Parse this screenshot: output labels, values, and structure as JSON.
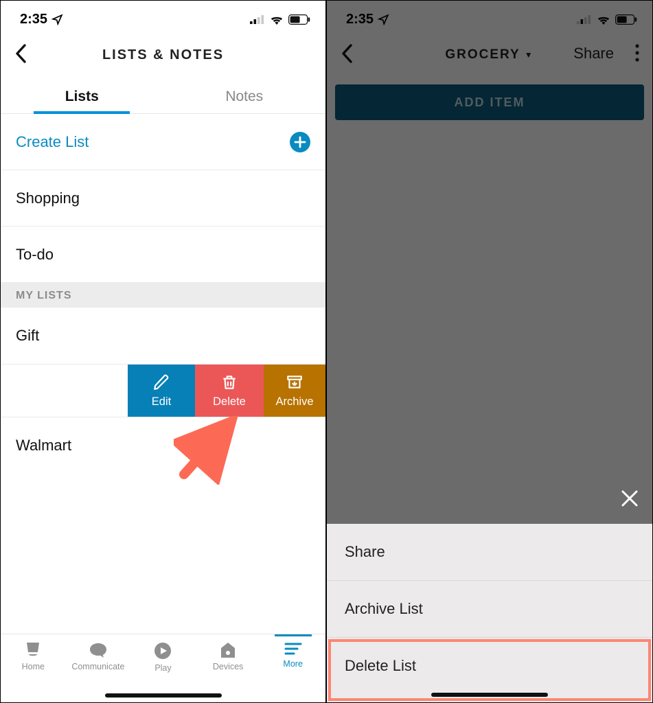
{
  "status": {
    "time": "2:35"
  },
  "left": {
    "header_title": "LISTS & NOTES",
    "tabs": {
      "lists": "Lists",
      "notes": "Notes"
    },
    "create_list": "Create List",
    "rows": {
      "shopping": "Shopping",
      "todo": "To-do",
      "gift": "Gift",
      "walmart": "Walmart"
    },
    "section_my_lists": "MY LISTS",
    "swipe": {
      "edit": "Edit",
      "delete": "Delete",
      "archive": "Archive"
    },
    "nav": {
      "home": "Home",
      "comm": "Communicate",
      "play": "Play",
      "devices": "Devices",
      "more": "More"
    }
  },
  "right": {
    "header_title": "GROCERY",
    "share": "Share",
    "add_item": "ADD ITEM",
    "sheet": {
      "share": "Share",
      "archive": "Archive List",
      "delete": "Delete List"
    }
  }
}
